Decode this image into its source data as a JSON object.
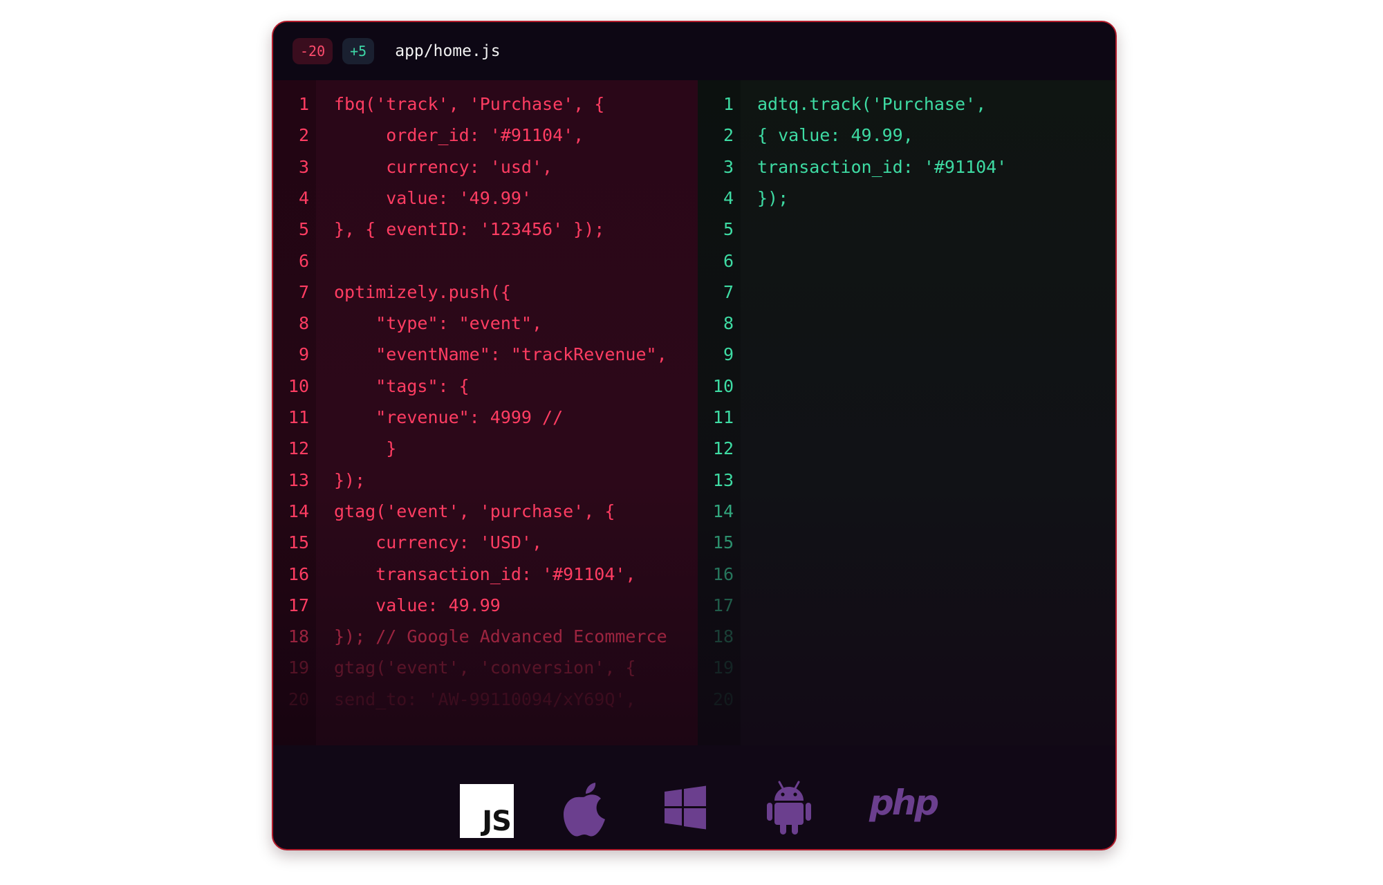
{
  "header": {
    "removed_badge": "-20",
    "added_badge": "+5",
    "filename": "app/home.js"
  },
  "left_lines": [
    {
      "n": "1",
      "code": "fbq('track', 'Purchase', {"
    },
    {
      "n": "2",
      "code": "     order_id: '#91104',"
    },
    {
      "n": "3",
      "code": "     currency: 'usd',"
    },
    {
      "n": "4",
      "code": "     value: '49.99'"
    },
    {
      "n": "5",
      "code": "}, { eventID: '123456' });"
    },
    {
      "n": "6",
      "code": ""
    },
    {
      "n": "7",
      "code": "optimizely.push({"
    },
    {
      "n": "8",
      "code": "    \"type\": \"event\","
    },
    {
      "n": "9",
      "code": "    \"eventName\": \"trackRevenue\","
    },
    {
      "n": "10",
      "code": "    \"tags\": {"
    },
    {
      "n": "11",
      "code": "    \"revenue\": 4999 //"
    },
    {
      "n": "12",
      "code": "     }"
    },
    {
      "n": "13",
      "code": "});"
    },
    {
      "n": "14",
      "code": "gtag('event', 'purchase', {"
    },
    {
      "n": "15",
      "code": "    currency: 'USD',"
    },
    {
      "n": "16",
      "code": "    transaction_id: '#91104',"
    },
    {
      "n": "17",
      "code": "    value: 49.99"
    },
    {
      "n": "18",
      "code": "}); // Google Advanced Ecommerce"
    },
    {
      "n": "19",
      "code": "gtag('event', 'conversion', {"
    },
    {
      "n": "20",
      "code": "send_to: 'AW-99110094/xY69Q',"
    }
  ],
  "right_lines": [
    {
      "n": "1",
      "code": "adtq.track('Purchase',"
    },
    {
      "n": "2",
      "code": "{ value: 49.99,"
    },
    {
      "n": "3",
      "code": "transaction_id: '#91104'"
    },
    {
      "n": "4",
      "code": "});"
    },
    {
      "n": "5",
      "code": ""
    },
    {
      "n": "6",
      "code": ""
    },
    {
      "n": "7",
      "code": ""
    },
    {
      "n": "8",
      "code": ""
    },
    {
      "n": "9",
      "code": ""
    },
    {
      "n": "10",
      "code": ""
    },
    {
      "n": "11",
      "code": ""
    },
    {
      "n": "12",
      "code": ""
    },
    {
      "n": "13",
      "code": ""
    },
    {
      "n": "14",
      "code": ""
    },
    {
      "n": "15",
      "code": ""
    },
    {
      "n": "16",
      "code": ""
    },
    {
      "n": "17",
      "code": ""
    },
    {
      "n": "18",
      "code": ""
    },
    {
      "n": "19",
      "code": ""
    },
    {
      "n": "20",
      "code": ""
    }
  ],
  "platforms": {
    "js_label": "JS",
    "php_label": "php",
    "icons": [
      "javascript-icon",
      "apple-icon",
      "windows-icon",
      "android-icon",
      "php-icon"
    ],
    "icon_color": "#6b3f8e"
  },
  "colors": {
    "removed": "#ff3d62",
    "added": "#3edba3",
    "border": "#b21c2c"
  }
}
